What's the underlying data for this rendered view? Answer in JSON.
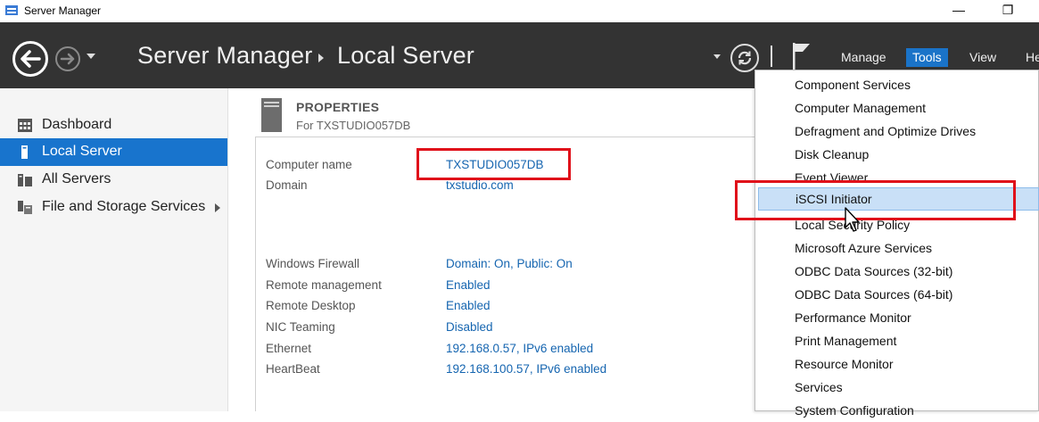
{
  "window": {
    "title": "Server Manager",
    "minimize_glyph": "—",
    "restore_glyph": "❐"
  },
  "header": {
    "breadcrumb_root": "Server Manager",
    "breadcrumb_current": "Local Server",
    "menus": [
      {
        "label": "Manage"
      },
      {
        "label": "Tools",
        "active": true
      },
      {
        "label": "View"
      },
      {
        "label": "He"
      }
    ]
  },
  "sidebar": {
    "items": [
      {
        "label": "Dashboard",
        "icon": "dashboard-icon"
      },
      {
        "label": "Local Server",
        "icon": "server-icon",
        "selected": true
      },
      {
        "label": "All Servers",
        "icon": "servers-icon"
      },
      {
        "label": "File and Storage Services",
        "icon": "storage-icon",
        "has_submenu": true
      }
    ]
  },
  "properties": {
    "title": "PROPERTIES",
    "subtitle": "For TXSTUDIO057DB",
    "rows": [
      {
        "label": "Computer name",
        "value": "TXSTUDIO057DB"
      },
      {
        "label": "Domain",
        "value": "txstudio.com"
      },
      {
        "label": "Windows Firewall",
        "value": "Domain: On, Public: On"
      },
      {
        "label": "Remote management",
        "value": "Enabled"
      },
      {
        "label": "Remote Desktop",
        "value": "Enabled"
      },
      {
        "label": "NIC Teaming",
        "value": "Disabled"
      },
      {
        "label": "Ethernet",
        "value": "192.168.0.57, IPv6 enabled"
      },
      {
        "label": "HeartBeat",
        "value": "192.168.100.57, IPv6 enabled"
      }
    ]
  },
  "tools_menu": {
    "items": [
      "Component Services",
      "Computer Management",
      "Defragment and Optimize Drives",
      "Disk Cleanup",
      "Event Viewer",
      "iSCSI Initiator",
      "Local Security Policy",
      "Microsoft Azure Services",
      "ODBC Data Sources (32-bit)",
      "ODBC Data Sources (64-bit)",
      "Performance Monitor",
      "Print Management",
      "Resource Monitor",
      "Services",
      "System Configuration"
    ],
    "hovered_index": 5
  },
  "colors": {
    "header_bg": "#333333",
    "accent": "#1874cd",
    "link": "#1565b0",
    "highlight_box": "#e0101a",
    "menu_hover": "#c9e0f7"
  }
}
